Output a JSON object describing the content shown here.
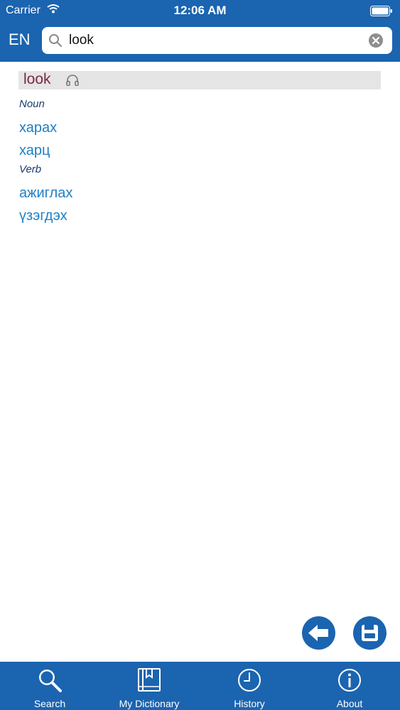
{
  "status": {
    "carrier": "Carrier",
    "time": "12:06 AM"
  },
  "header": {
    "language": "EN"
  },
  "search": {
    "query": "look"
  },
  "entry": {
    "headword": "look",
    "sections": [
      {
        "pos": "Noun",
        "translations": [
          "харах",
          "харц"
        ]
      },
      {
        "pos": "Verb",
        "translations": [
          "ажиглах",
          "үзэгдэх"
        ]
      }
    ]
  },
  "tabs": [
    {
      "label": "Search",
      "icon": "search-icon"
    },
    {
      "label": "My Dictionary",
      "icon": "book-icon"
    },
    {
      "label": "History",
      "icon": "clock-icon"
    },
    {
      "label": "About",
      "icon": "info-icon"
    }
  ],
  "colors": {
    "brand": "#1b64b0",
    "headword": "#7a2845",
    "translation": "#1f7fc4",
    "pos": "#1a3d6b"
  }
}
